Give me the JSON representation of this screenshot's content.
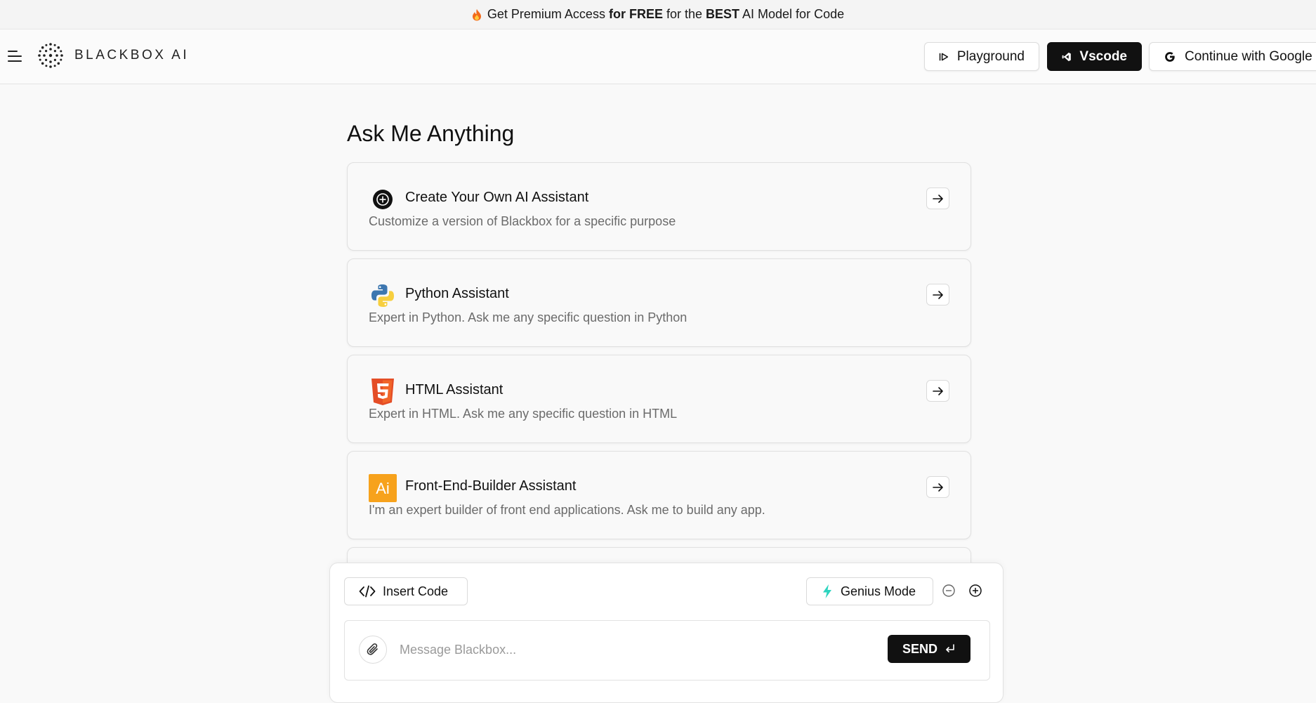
{
  "promo": {
    "part1": "Get Premium Access ",
    "bold1": "for FREE",
    "part2": " for the ",
    "bold2": "BEST",
    "part3": " AI Model for Code"
  },
  "header": {
    "logo_text": "BLACKBOX AI",
    "playground_label": "Playground",
    "vscode_label": "Vscode",
    "google_label": "Continue with Google"
  },
  "main": {
    "title": "Ask Me Anything",
    "cards": [
      {
        "title": "Create Your Own AI Assistant",
        "desc": "Customize a version of Blackbox for a specific purpose",
        "icon": "plus-circle-icon"
      },
      {
        "title": "Python Assistant",
        "desc": "Expert in Python. Ask me any specific question in Python",
        "icon": "python-icon"
      },
      {
        "title": "HTML Assistant",
        "desc": "Expert in HTML. Ask me any specific question in HTML",
        "icon": "html5-icon"
      },
      {
        "title": "Front-End-Builder Assistant",
        "desc": "I'm an expert builder of front end applications. Ask me to build any app.",
        "icon": "ai-icon"
      }
    ]
  },
  "composer": {
    "insert_code_label": "Insert Code",
    "genius_label": "Genius Mode",
    "placeholder": "Message Blackbox...",
    "send_label": "SEND"
  },
  "colors": {
    "accent_dark": "#111111",
    "genius_bolt": "#2dd4bf",
    "html_orange": "#e44d26",
    "ai_orange": "#f7a21c"
  }
}
